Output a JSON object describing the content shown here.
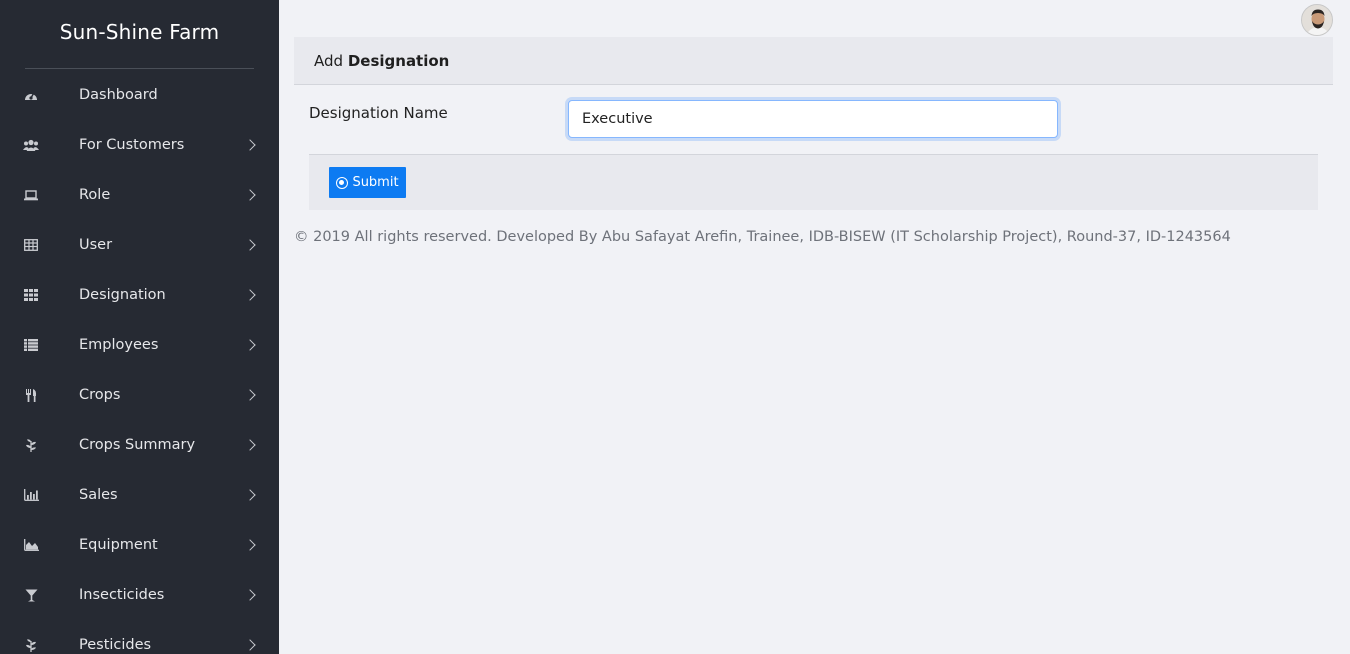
{
  "sidebar": {
    "brand": "Sun-Shine Farm",
    "items": [
      {
        "label": "Dashboard",
        "icon": "dashboard-icon",
        "has_submenu": false
      },
      {
        "label": "For Customers",
        "icon": "users-icon",
        "has_submenu": true
      },
      {
        "label": "Role",
        "icon": "laptop-icon",
        "has_submenu": true
      },
      {
        "label": "User",
        "icon": "table-icon",
        "has_submenu": true
      },
      {
        "label": "Designation",
        "icon": "grid-icon",
        "has_submenu": true
      },
      {
        "label": "Employees",
        "icon": "list-icon",
        "has_submenu": true
      },
      {
        "label": "Crops",
        "icon": "cutlery-icon",
        "has_submenu": true
      },
      {
        "label": "Crops Summary",
        "icon": "pagelines-icon",
        "has_submenu": true
      },
      {
        "label": "Sales",
        "icon": "bar-chart-icon",
        "has_submenu": true
      },
      {
        "label": "Equipment",
        "icon": "area-chart-icon",
        "has_submenu": true
      },
      {
        "label": "Insecticides",
        "icon": "glass-icon",
        "has_submenu": true
      },
      {
        "label": "Pesticides",
        "icon": "pagelines-icon",
        "has_submenu": true
      }
    ]
  },
  "header": {
    "avatar_icon": "user-avatar"
  },
  "card": {
    "title_prefix": "Add",
    "title_bold": "Designation",
    "field_label": "Designation Name",
    "field_value": "Executive",
    "submit_label": "Submit"
  },
  "footer": {
    "text": "© 2019 All rights reserved. Developed By Abu Safayat Arefin, Trainee, IDB-BISEW (IT Scholarship Project), Round-37, ID-1243564"
  },
  "colors": {
    "sidebar_bg": "#262a33",
    "content_bg": "#f1f2f6",
    "primary_button": "#0d7bf2"
  }
}
